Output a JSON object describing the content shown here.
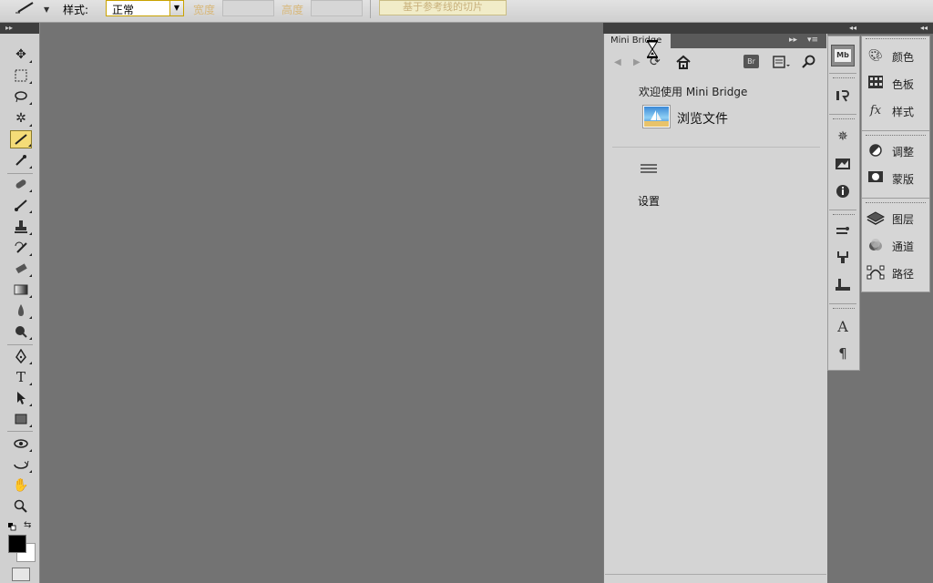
{
  "options_bar": {
    "style_label": "样式:",
    "style_value": "正常",
    "width_label": "宽度",
    "height_label": "高度",
    "slice_button": "基于参考线的切片"
  },
  "mini_bridge": {
    "tab_title": "Mini Bridge",
    "br_label": "Br",
    "welcome_text": "欢迎使用 Mini Bridge",
    "browse_files": "浏览文件",
    "settings": "设置"
  },
  "strip": {
    "active_label": "Mb"
  },
  "panels": {
    "color": "颜色",
    "swatches": "色板",
    "styles": "样式",
    "adjustments": "调整",
    "masks": "蒙版",
    "layers": "图层",
    "channels": "通道",
    "paths": "路径"
  },
  "icons": [
    "move-icon",
    "marquee-icon",
    "lasso-icon",
    "quick-select-icon",
    "slice-icon",
    "eyedropper-icon",
    "healing-icon",
    "brush-icon",
    "stamp-icon",
    "history-brush-icon",
    "eraser-icon",
    "gradient-icon",
    "blur-icon",
    "dodge-icon",
    "pen-icon",
    "type-icon",
    "path-select-icon",
    "rectangle-icon",
    "3d-rotate-icon",
    "3d-orbit-icon",
    "hand-icon",
    "zoom-icon"
  ],
  "colors": {
    "canvas": "#737373",
    "active_tool": "#f4dc78",
    "foreground": "#000000",
    "background": "#ffffff"
  }
}
